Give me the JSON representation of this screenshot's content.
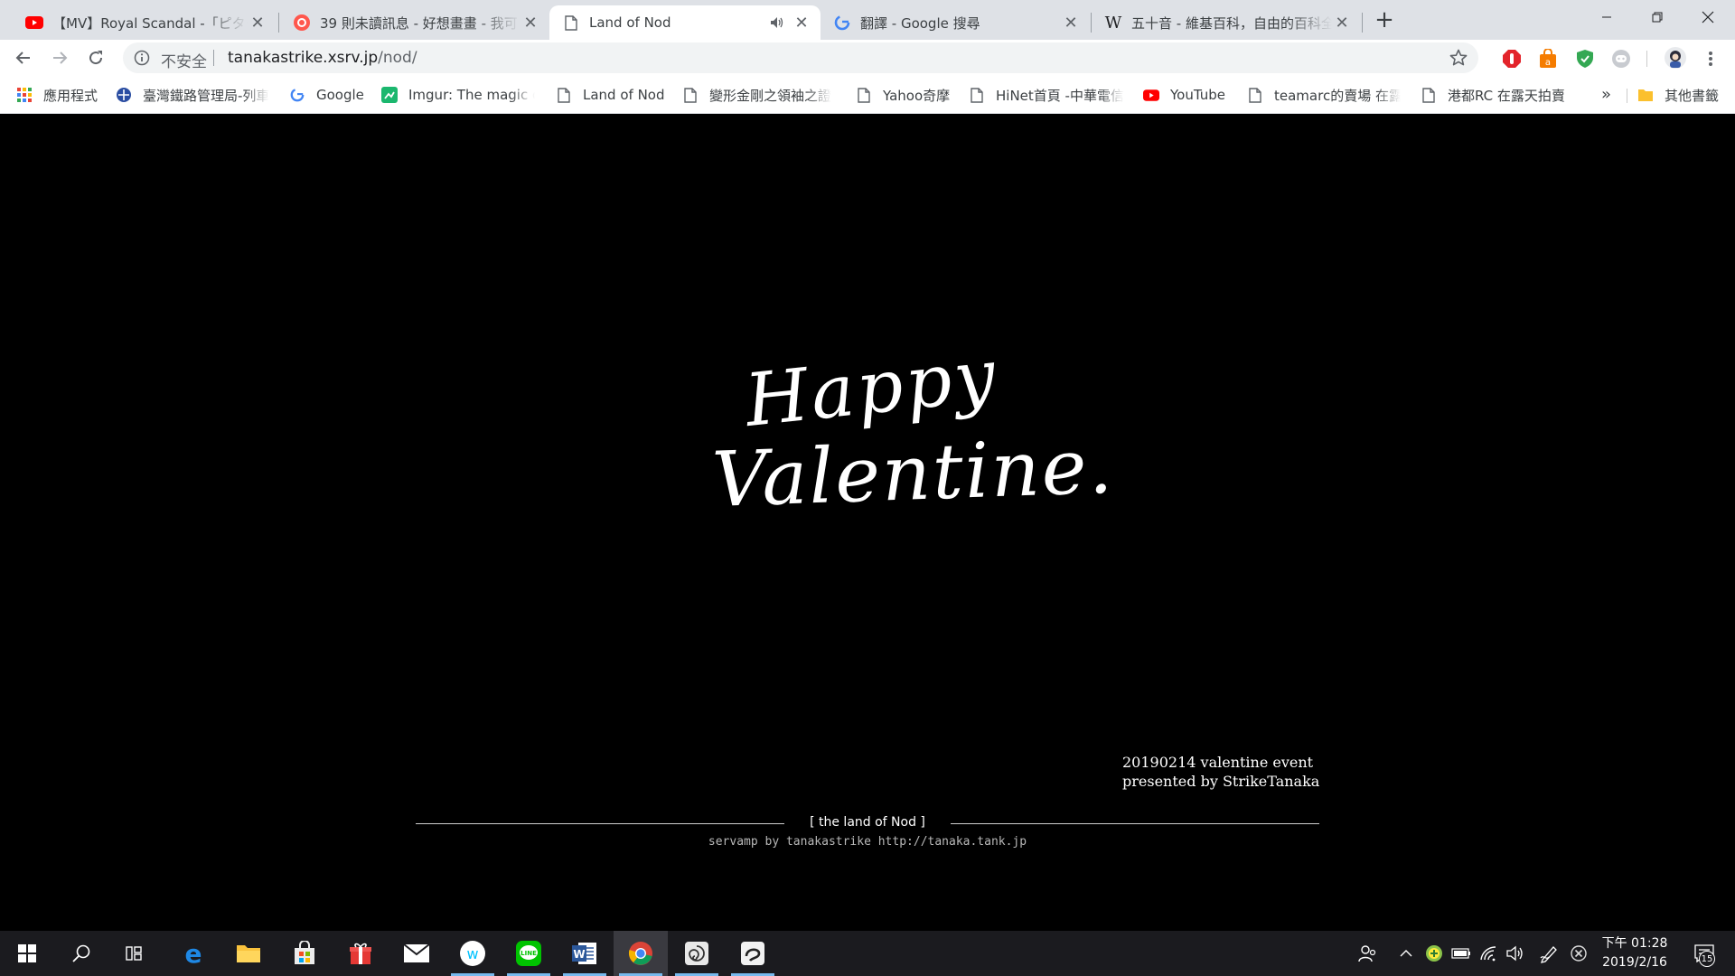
{
  "browser": {
    "tabs": [
      {
        "title": "【MV】Royal Scandal -「ピター",
        "favicon": "youtube-icon",
        "active": false
      },
      {
        "title": "39 則未讀訊息 - 好想畫畫 - 我可",
        "favicon": "plurk-icon",
        "active": false
      },
      {
        "title": "Land of Nod",
        "favicon": "page-icon",
        "active": true,
        "audio": "speaker-icon"
      },
      {
        "title": "翻譯 - Google 搜尋",
        "favicon": "google-icon",
        "active": false
      },
      {
        "title": "五十音 - 維基百科，自由的百科全",
        "favicon": "wikipedia-icon",
        "active": false
      }
    ],
    "new_tab": "+",
    "omnibox": {
      "security_label": "不安全",
      "url_domain": "tanakastrike.xsrv.jp",
      "url_path": "/nod/"
    },
    "bookmarks": [
      {
        "label": "應用程式",
        "icon": "apps-grid-icon"
      },
      {
        "label": "臺灣鐵路管理局-列車",
        "icon": "tra-logo-icon"
      },
      {
        "label": "Google",
        "icon": "google-icon"
      },
      {
        "label": "Imgur: The magic of",
        "icon": "imgur-icon"
      },
      {
        "label": "Land of Nod",
        "icon": "page-icon"
      },
      {
        "label": "變形金剛之領袖之證",
        "icon": "page-icon"
      },
      {
        "label": "Yahoo奇摩",
        "icon": "page-icon"
      },
      {
        "label": "HiNet首頁 -中華電信",
        "icon": "page-icon"
      },
      {
        "label": "YouTube",
        "icon": "youtube-icon"
      },
      {
        "label": "teamarc的賣場 在露",
        "icon": "page-icon"
      },
      {
        "label": "港都RC 在露天拍賣",
        "icon": "page-icon"
      }
    ],
    "bookmarks_more": "»",
    "other_bookmarks": "其他書籤"
  },
  "page": {
    "headline_line1": "Happy",
    "headline_line2": "Valentine.",
    "event_line1": "20190214 valentine event",
    "event_line2": "presented by StrikeTanaka",
    "footer_title": "[ the land of Nod ]",
    "footer_credit": "servamp by tanakastrike http://tanaka.tank.jp"
  },
  "taskbar": {
    "clock_label": "下午 01:28",
    "date_label": "2019/2/16",
    "notification_count": "15"
  },
  "colors": {
    "tabstrip_bg": "#dee1e6",
    "page_bg": "#000000",
    "taskbar_bg": "#1b1b1f",
    "accent": "#76b9ed"
  }
}
